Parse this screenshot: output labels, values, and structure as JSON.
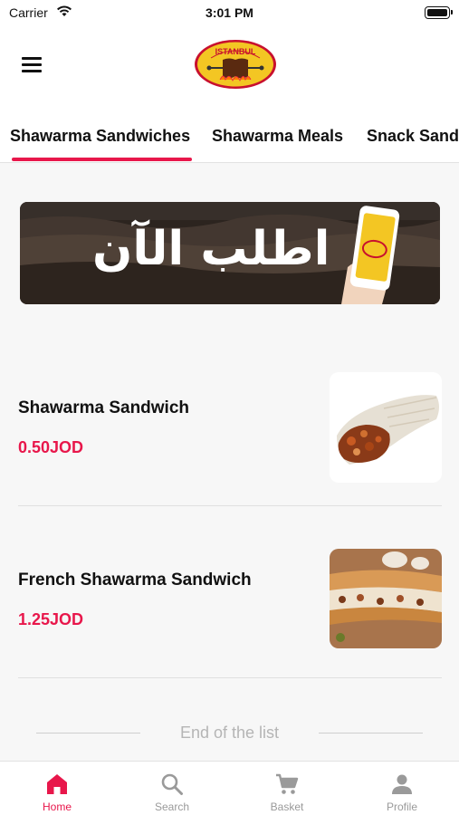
{
  "status_bar": {
    "carrier": "Carrier",
    "time": "3:01 PM"
  },
  "header": {
    "logo_text": "ISTANBUL"
  },
  "tabs": [
    {
      "label": "Shawarma Sandwiches",
      "active": true
    },
    {
      "label": "Shawarma Meals",
      "active": false
    },
    {
      "label": "Snack Sand",
      "active": false
    }
  ],
  "banner": {
    "text": "اطلب الآن"
  },
  "products": [
    {
      "name": "Shawarma Sandwich",
      "price": "0.50JOD"
    },
    {
      "name": "French Shawarma Sandwich",
      "price": "1.25JOD"
    }
  ],
  "end_of_list": "End of the list",
  "bottom_nav": [
    {
      "label": "Home",
      "icon": "home-icon",
      "active": true
    },
    {
      "label": "Search",
      "icon": "search-icon",
      "active": false
    },
    {
      "label": "Basket",
      "icon": "cart-icon",
      "active": false
    },
    {
      "label": "Profile",
      "icon": "person-icon",
      "active": false
    }
  ],
  "colors": {
    "accent": "#e8174b",
    "logo_yellow": "#f3c623",
    "logo_red": "#c8102e"
  }
}
